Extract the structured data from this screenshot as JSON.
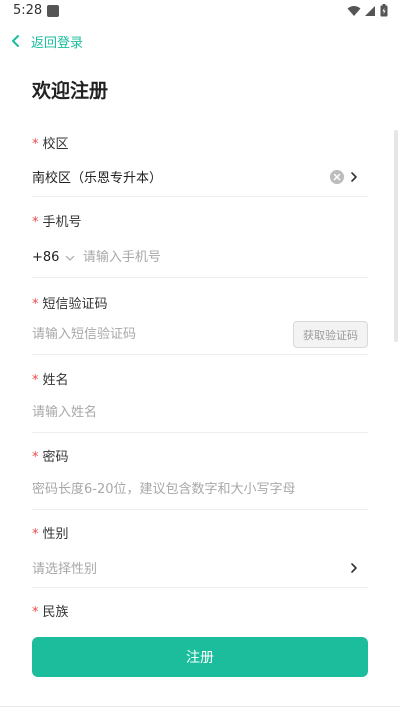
{
  "status_bar": {
    "time": "5:28"
  },
  "nav": {
    "back_label": "返回登录"
  },
  "page": {
    "title": "欢迎注册"
  },
  "required_mark": "*",
  "fields": {
    "campus": {
      "label": "校区",
      "value": "南校区（乐恩专升本）"
    },
    "phone": {
      "label": "手机号",
      "country_code": "+86",
      "placeholder": "请输入手机号"
    },
    "sms_code": {
      "label": "短信验证码",
      "placeholder": "请输入短信验证码",
      "button_label": "获取验证码"
    },
    "name": {
      "label": "姓名",
      "placeholder": "请输入姓名"
    },
    "password": {
      "label": "密码",
      "placeholder": "密码长度6-20位，建议包含数字和大小写字母"
    },
    "gender": {
      "label": "性别",
      "placeholder": "请选择性别"
    },
    "ethnicity": {
      "label": "民族"
    }
  },
  "submit": {
    "label": "注册"
  },
  "colors": {
    "accent": "#1bbd9c",
    "required": "#e94b4b"
  },
  "icons": [
    "wifi-icon",
    "signal-icon",
    "battery-icon",
    "back-chevron-icon",
    "clear-icon",
    "chevron-right-icon",
    "chevron-down-icon"
  ]
}
